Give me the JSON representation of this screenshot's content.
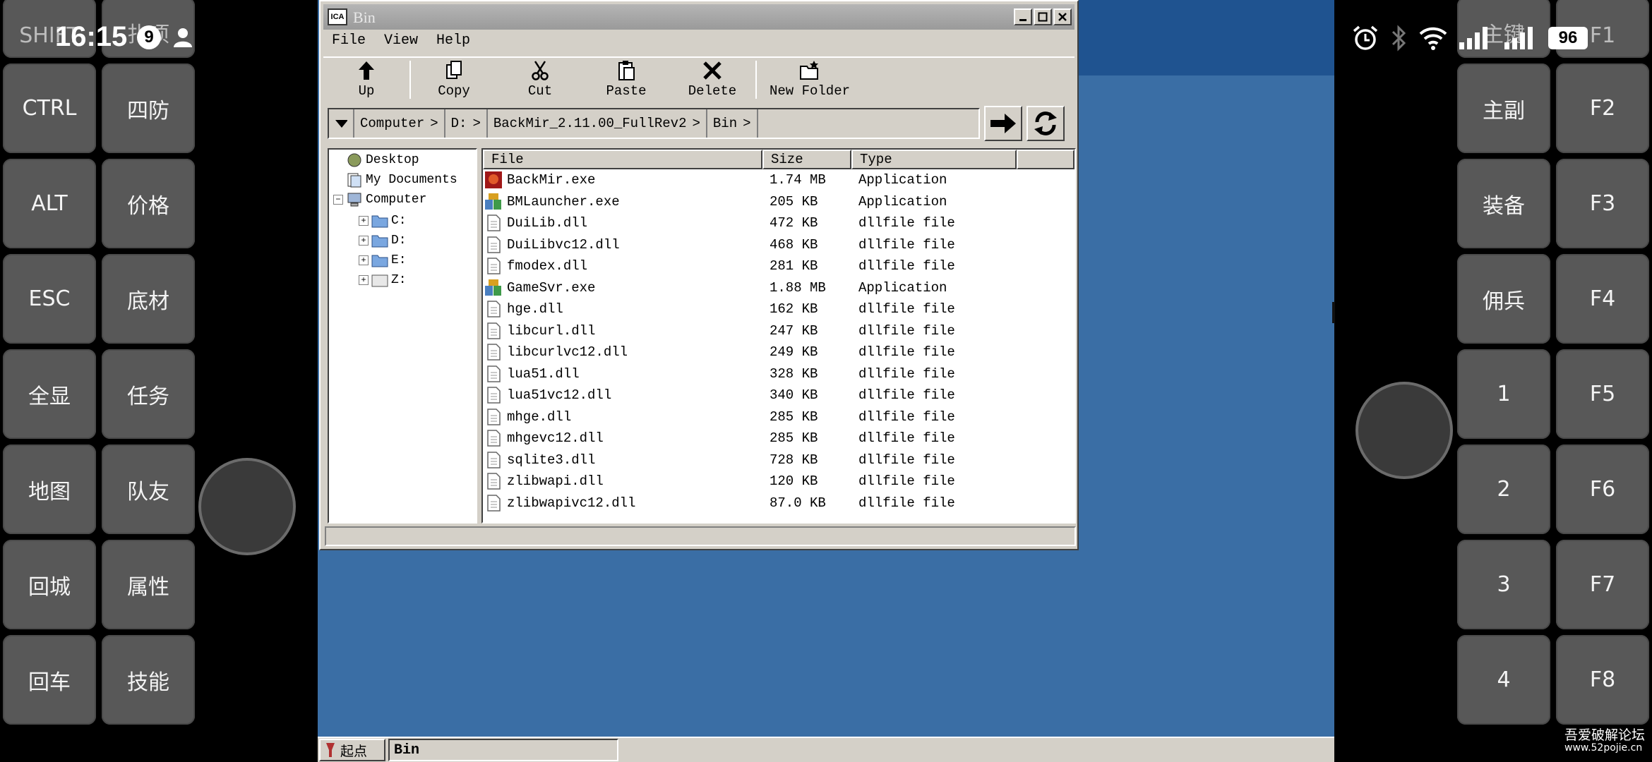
{
  "status_bar": {
    "time": "16:15",
    "notification_count": "9",
    "battery": "96",
    "icons": [
      "alarm-icon",
      "bluetooth-icon",
      "wifi-icon",
      "signal-icon",
      "signal-icon",
      "battery-icon"
    ]
  },
  "left_pad": {
    "keys": [
      "SHIFT",
      "扎项",
      "CTRL",
      "四防",
      "ALT",
      "价格",
      "ESC",
      "底材",
      "全显",
      "任务",
      "地图",
      "队友",
      "回城",
      "属性",
      "回车",
      "技能"
    ]
  },
  "right_pad": {
    "keys": [
      "主键",
      "F1",
      "主副",
      "F2",
      "装备",
      "F3",
      "佣兵",
      "F4",
      "1",
      "F5",
      "2",
      "F6",
      "3",
      "F7",
      "4",
      "F8"
    ]
  },
  "window": {
    "title": "Bin",
    "app_icon_label": "ICA",
    "menu": [
      "File",
      "View",
      "Help"
    ],
    "toolbar": {
      "up": "Up",
      "copy": "Copy",
      "cut": "Cut",
      "paste": "Paste",
      "delete": "Delete",
      "new_folder": "New Folder"
    },
    "breadcrumbs": [
      "Computer",
      "D:",
      "BackMir_2.11.00_FullRev2",
      "Bin"
    ],
    "tree": {
      "desktop": "Desktop",
      "my_documents": "My Documents",
      "computer": "Computer",
      "drives": [
        "C:",
        "D:",
        "E:",
        "Z:"
      ]
    },
    "columns": [
      "File",
      "Size",
      "Type"
    ],
    "files": [
      {
        "name": "BackMir.exe",
        "size": "1.74 MB",
        "type": "Application",
        "icon": "backmir-app-icon"
      },
      {
        "name": "BMLauncher.exe",
        "size": "205 KB",
        "type": "Application",
        "icon": "launcher-app-icon"
      },
      {
        "name": "DuiLib.dll",
        "size": "472 KB",
        "type": "dllfile file",
        "icon": "document-icon"
      },
      {
        "name": "DuiLibvc12.dll",
        "size": "468 KB",
        "type": "dllfile file",
        "icon": "document-icon"
      },
      {
        "name": "fmodex.dll",
        "size": "281 KB",
        "type": "dllfile file",
        "icon": "document-icon"
      },
      {
        "name": "GameSvr.exe",
        "size": "1.88 MB",
        "type": "Application",
        "icon": "launcher-app-icon"
      },
      {
        "name": "hge.dll",
        "size": "162 KB",
        "type": "dllfile file",
        "icon": "document-icon"
      },
      {
        "name": "libcurl.dll",
        "size": "247 KB",
        "type": "dllfile file",
        "icon": "document-icon"
      },
      {
        "name": "libcurlvc12.dll",
        "size": "249 KB",
        "type": "dllfile file",
        "icon": "document-icon"
      },
      {
        "name": "lua51.dll",
        "size": "328 KB",
        "type": "dllfile file",
        "icon": "document-icon"
      },
      {
        "name": "lua51vc12.dll",
        "size": "340 KB",
        "type": "dllfile file",
        "icon": "document-icon"
      },
      {
        "name": "mhge.dll",
        "size": "285 KB",
        "type": "dllfile file",
        "icon": "document-icon"
      },
      {
        "name": "mhgevc12.dll",
        "size": "285 KB",
        "type": "dllfile file",
        "icon": "document-icon"
      },
      {
        "name": "sqlite3.dll",
        "size": "728 KB",
        "type": "dllfile file",
        "icon": "document-icon"
      },
      {
        "name": "zlibwapi.dll",
        "size": "120 KB",
        "type": "dllfile file",
        "icon": "document-icon"
      },
      {
        "name": "zlibwapivc12.dll",
        "size": "87.0 KB",
        "type": "dllfile file",
        "icon": "document-icon"
      }
    ]
  },
  "taskbar": {
    "start_label": "起点",
    "task_label": "Bin"
  },
  "watermark": {
    "line1": "吾爱破解论坛",
    "line2": "www.52pojie.cn"
  },
  "colors": {
    "desktop": "#3a6ea5",
    "window_face": "#d4d0c8",
    "key_face": "#585858"
  }
}
